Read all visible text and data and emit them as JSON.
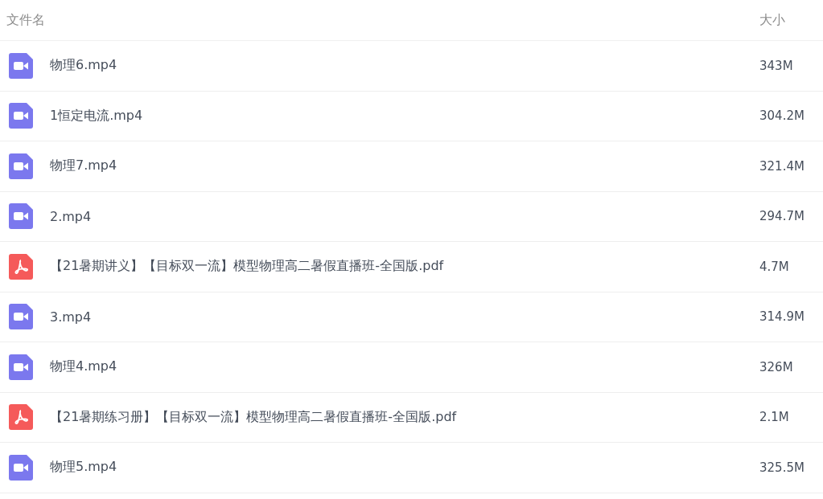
{
  "table": {
    "columns": [
      "文件名",
      "大小"
    ],
    "rows": [
      {
        "kind": "video",
        "name": "物理6.mp4",
        "size": "343M"
      },
      {
        "kind": "video",
        "name": "1恒定电流.mp4",
        "size": "304.2M"
      },
      {
        "kind": "video",
        "name": "物理7.mp4",
        "size": "321.4M"
      },
      {
        "kind": "video",
        "name": "2.mp4",
        "size": "294.7M"
      },
      {
        "kind": "pdf",
        "name": "【21暑期讲义】【目标双一流】模型物理高二暑假直播班-全国版.pdf",
        "size": "4.7M"
      },
      {
        "kind": "video",
        "name": "3.mp4",
        "size": "314.9M"
      },
      {
        "kind": "video",
        "name": "物理4.mp4",
        "size": "326M"
      },
      {
        "kind": "pdf",
        "name": "【21暑期练习册】【目标双一流】模型物理高二暑假直播班-全国版.pdf",
        "size": "2.1M"
      },
      {
        "kind": "video",
        "name": "物理5.mp4",
        "size": "325.5M"
      }
    ]
  }
}
